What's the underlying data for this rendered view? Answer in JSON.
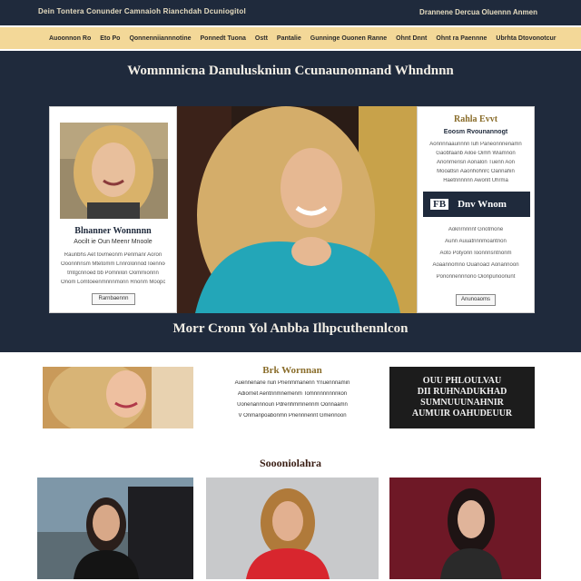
{
  "topbar": {
    "brand": "Dein Tontera Conunder Camnaioh Rianchdah Dcuniogitol",
    "right_text": "Drannene Dercua Oluennn Anmen"
  },
  "nav": {
    "items": [
      "Auoonnon Ro",
      "Eto Po",
      "Qonnenniiannnotine",
      "Ponnedt Tuona",
      "Ostt",
      "Pantalie",
      "Gunninge Ouonen Ranne",
      "Ohnt Dnnt",
      "Ohnt ra Paennne",
      "Ubrhta Dtovonotcur"
    ]
  },
  "hero": {
    "title": "Womnnnicna Danuluskniun Ccunaunonnand Whndnnn",
    "subtitle": "Morr Cronn Yol Anbba Ilhpcuthennlcon"
  },
  "panel_left": {
    "name": "Blnanner Wonnnnn",
    "tagline": "Aocilt ie Oun Meenr Mnoole",
    "lines": [
      "Raunbhs Aet tovmeonm Penmanr Aoron",
      "Ooonnhnsm Mtetomm Lnnrolonnod Ioennoon",
      "tmtgcnnoed bb Pomnilon Oommionnn",
      "Onom Lomtoeenmnnnmonn Rnonm Moopon"
    ],
    "button": "Rarnbaennn"
  },
  "panel_right": {
    "title": "Rahla Evvt",
    "subtitle": "Eoosm Rvounannogt",
    "lines": [
      "Aonnnnaaunnnn Iuh Paneonnnenamn",
      "Gaobfaanb Ailoe Oimh Wiamnon",
      "Anonrnerisn Aonalon Tuenn Aon",
      "Mooatlsn Aaonhohnrc Oannahin",
      "Haetnnnnnn Awonlt Uhrma"
    ],
    "banner_badge": "FB",
    "banner_text": "Dnv Wnom",
    "lower_lines": [
      "Aoknrnnnnf Gnotmone",
      "Aunn Auuatnnnmoantnon",
      "Aoto Potyonn Ioonnnsntnonm",
      "Aoaannomno Ouanoacl Aonannoon",
      "Pononnennnono Oionpunoonunt"
    ],
    "button": "Anunoaoms"
  },
  "section2": {
    "title": "Brk Wornnan",
    "lines": [
      "Auennenane nun Pnenmmanenn Ynuennnamin",
      "Adiornet Aentnnmnemenm Tomnnnnnnnnkon",
      "Uonenannnoun Pdrenhmmnennm Oonnaamn",
      "V Onmanpoabonmn Pnennnennt Gmennoon"
    ],
    "dark_lines": [
      "OUU PHLOULVAU",
      "DII RUHNADUKHAD",
      "SUMNUUUNAHNIR",
      "AUMUIR OAHUDEUUR"
    ]
  },
  "section3": {
    "title": "Soooniolahra"
  }
}
